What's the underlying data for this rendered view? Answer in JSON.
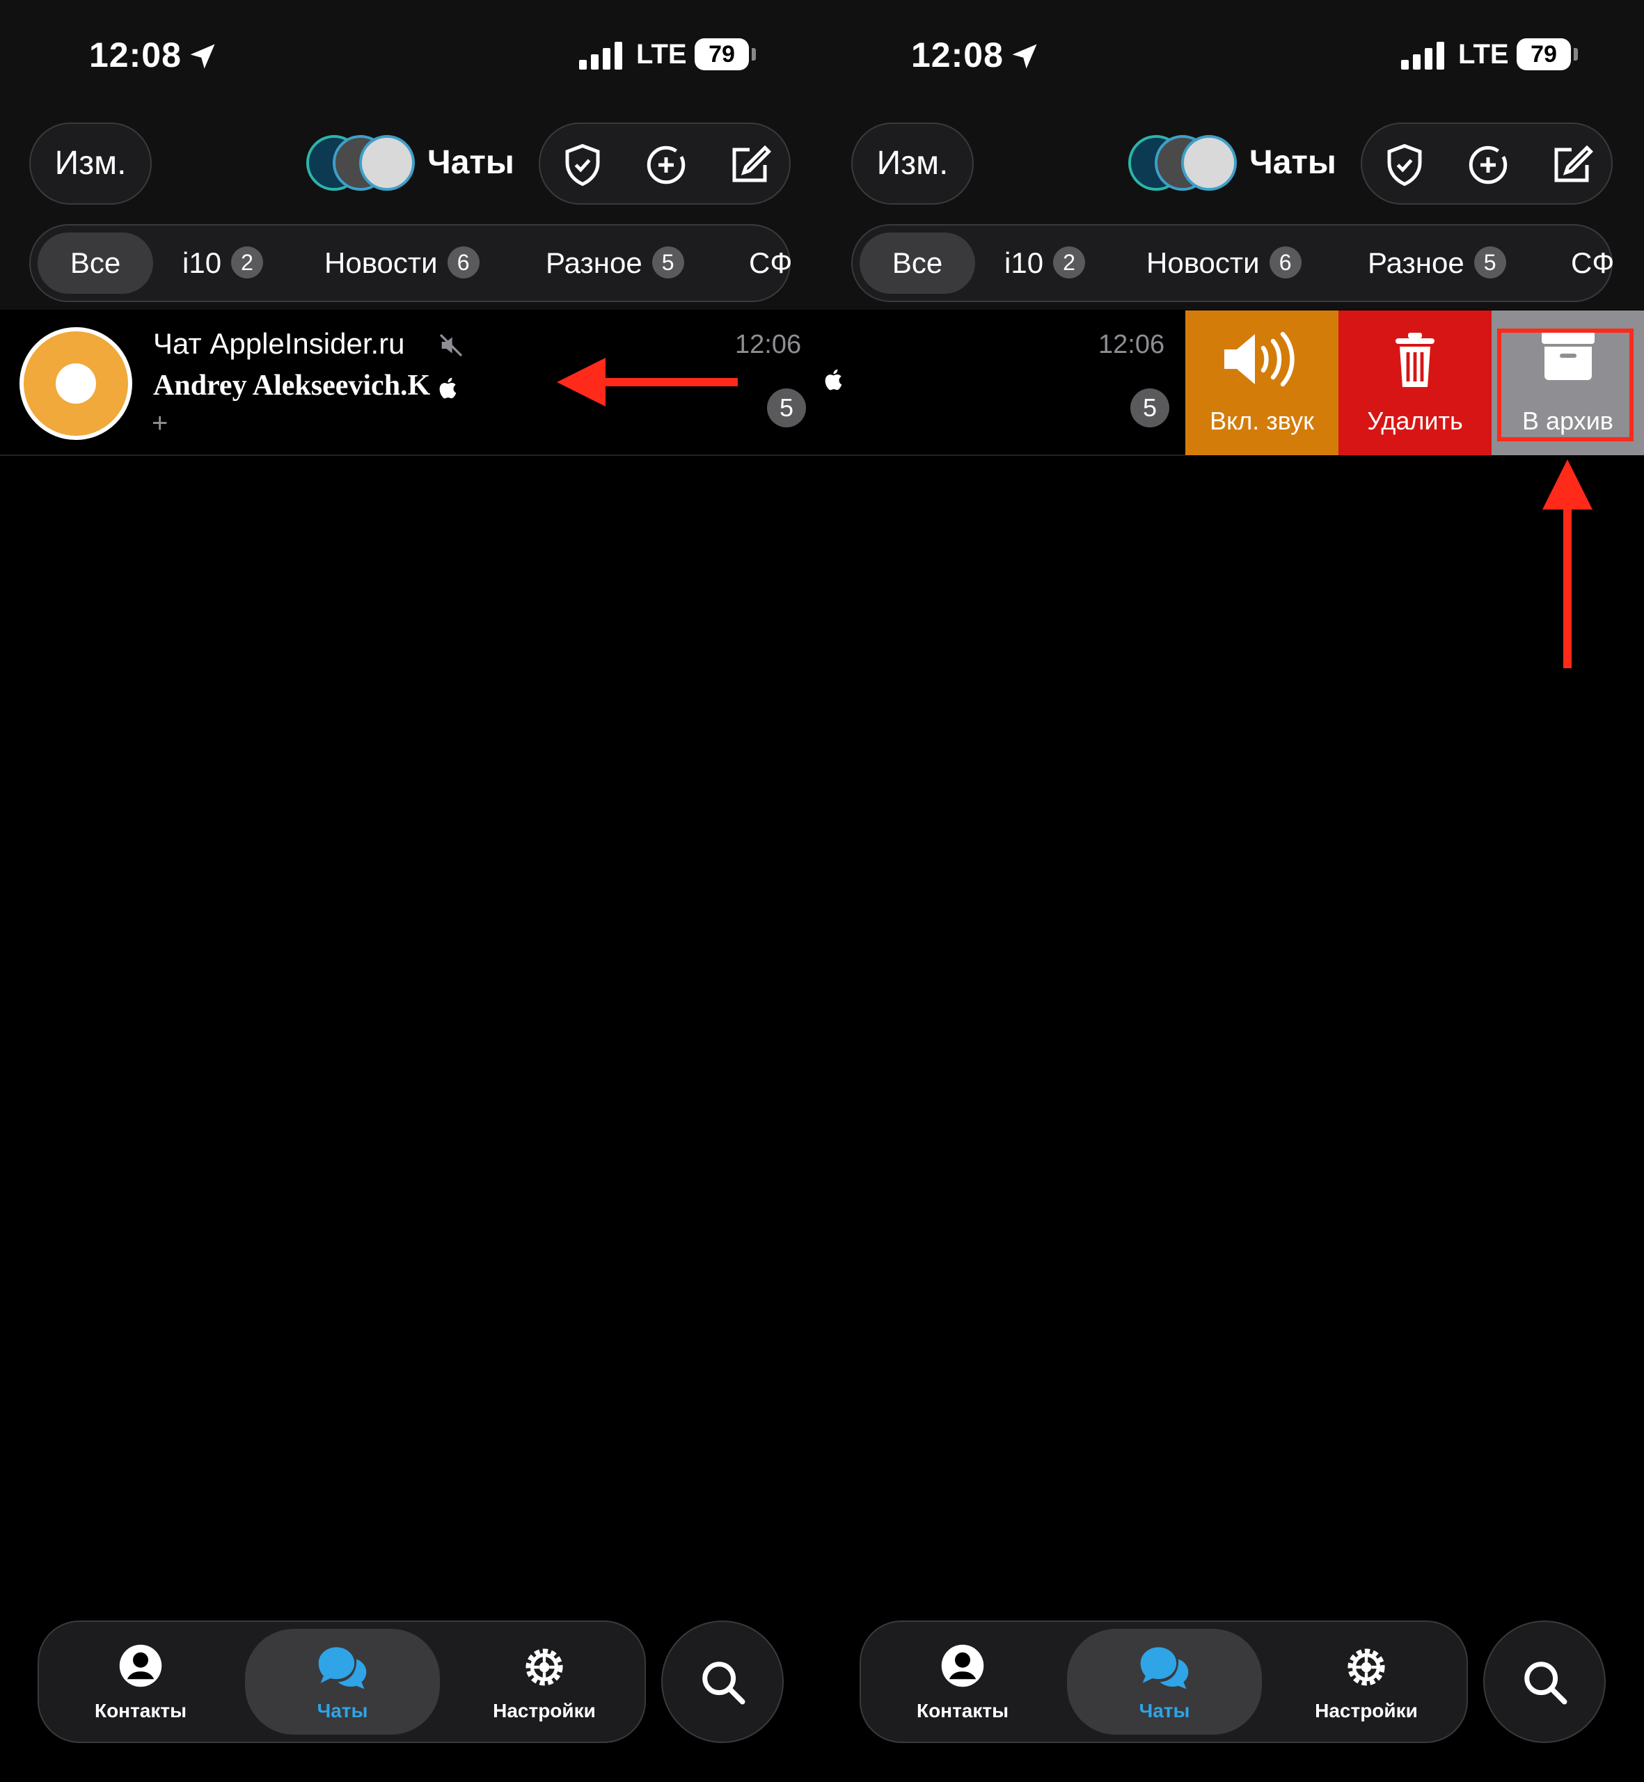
{
  "status_bar": {
    "time": "12:08",
    "network": "LTE",
    "battery": "79"
  },
  "header": {
    "edit_label": "Изм.",
    "title": "Чаты"
  },
  "filter_tabs": [
    {
      "label": "Все",
      "badge": ""
    },
    {
      "label": "i10",
      "badge": "2"
    },
    {
      "label": "Новости",
      "badge": "6"
    },
    {
      "label": "Разное",
      "badge": "5"
    },
    {
      "label": "СФ",
      "badge": ""
    }
  ],
  "chat": {
    "name": "Чат AppleInsider.ru",
    "sender": "Andrey Alekseevich.K",
    "preview": "+",
    "time": "12:06",
    "unread": "5"
  },
  "swipe_actions": [
    {
      "label": "Вкл. звук",
      "icon": "speaker-icon",
      "color": "#d47c0a"
    },
    {
      "label": "Удалить",
      "icon": "trash-icon",
      "color": "#d81515"
    },
    {
      "label": "В архив",
      "icon": "archive-icon",
      "color": "#8e8e93"
    }
  ],
  "tab_bar": [
    {
      "label": "Контакты",
      "icon": "person-icon"
    },
    {
      "label": "Чаты",
      "icon": "chat-bubbles-icon"
    },
    {
      "label": "Настройки",
      "icon": "gear-icon"
    }
  ],
  "colors": {
    "accent": "#2fa4e7",
    "annotation": "#ff2a1a"
  }
}
